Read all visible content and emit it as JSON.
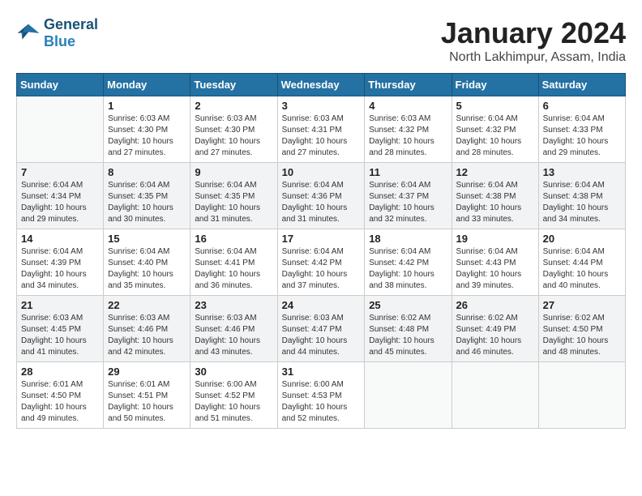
{
  "header": {
    "logo_line1": "General",
    "logo_line2": "Blue",
    "month": "January 2024",
    "location": "North Lakhimpur, Assam, India"
  },
  "days_of_week": [
    "Sunday",
    "Monday",
    "Tuesday",
    "Wednesday",
    "Thursday",
    "Friday",
    "Saturday"
  ],
  "weeks": [
    [
      {
        "day": "",
        "sunrise": "",
        "sunset": "",
        "daylight": ""
      },
      {
        "day": "1",
        "sunrise": "Sunrise: 6:03 AM",
        "sunset": "Sunset: 4:30 PM",
        "daylight": "Daylight: 10 hours and 27 minutes."
      },
      {
        "day": "2",
        "sunrise": "Sunrise: 6:03 AM",
        "sunset": "Sunset: 4:30 PM",
        "daylight": "Daylight: 10 hours and 27 minutes."
      },
      {
        "day": "3",
        "sunrise": "Sunrise: 6:03 AM",
        "sunset": "Sunset: 4:31 PM",
        "daylight": "Daylight: 10 hours and 27 minutes."
      },
      {
        "day": "4",
        "sunrise": "Sunrise: 6:03 AM",
        "sunset": "Sunset: 4:32 PM",
        "daylight": "Daylight: 10 hours and 28 minutes."
      },
      {
        "day": "5",
        "sunrise": "Sunrise: 6:04 AM",
        "sunset": "Sunset: 4:32 PM",
        "daylight": "Daylight: 10 hours and 28 minutes."
      },
      {
        "day": "6",
        "sunrise": "Sunrise: 6:04 AM",
        "sunset": "Sunset: 4:33 PM",
        "daylight": "Daylight: 10 hours and 29 minutes."
      }
    ],
    [
      {
        "day": "7",
        "sunrise": "Sunrise: 6:04 AM",
        "sunset": "Sunset: 4:34 PM",
        "daylight": "Daylight: 10 hours and 29 minutes."
      },
      {
        "day": "8",
        "sunrise": "Sunrise: 6:04 AM",
        "sunset": "Sunset: 4:35 PM",
        "daylight": "Daylight: 10 hours and 30 minutes."
      },
      {
        "day": "9",
        "sunrise": "Sunrise: 6:04 AM",
        "sunset": "Sunset: 4:35 PM",
        "daylight": "Daylight: 10 hours and 31 minutes."
      },
      {
        "day": "10",
        "sunrise": "Sunrise: 6:04 AM",
        "sunset": "Sunset: 4:36 PM",
        "daylight": "Daylight: 10 hours and 31 minutes."
      },
      {
        "day": "11",
        "sunrise": "Sunrise: 6:04 AM",
        "sunset": "Sunset: 4:37 PM",
        "daylight": "Daylight: 10 hours and 32 minutes."
      },
      {
        "day": "12",
        "sunrise": "Sunrise: 6:04 AM",
        "sunset": "Sunset: 4:38 PM",
        "daylight": "Daylight: 10 hours and 33 minutes."
      },
      {
        "day": "13",
        "sunrise": "Sunrise: 6:04 AM",
        "sunset": "Sunset: 4:38 PM",
        "daylight": "Daylight: 10 hours and 34 minutes."
      }
    ],
    [
      {
        "day": "14",
        "sunrise": "Sunrise: 6:04 AM",
        "sunset": "Sunset: 4:39 PM",
        "daylight": "Daylight: 10 hours and 34 minutes."
      },
      {
        "day": "15",
        "sunrise": "Sunrise: 6:04 AM",
        "sunset": "Sunset: 4:40 PM",
        "daylight": "Daylight: 10 hours and 35 minutes."
      },
      {
        "day": "16",
        "sunrise": "Sunrise: 6:04 AM",
        "sunset": "Sunset: 4:41 PM",
        "daylight": "Daylight: 10 hours and 36 minutes."
      },
      {
        "day": "17",
        "sunrise": "Sunrise: 6:04 AM",
        "sunset": "Sunset: 4:42 PM",
        "daylight": "Daylight: 10 hours and 37 minutes."
      },
      {
        "day": "18",
        "sunrise": "Sunrise: 6:04 AM",
        "sunset": "Sunset: 4:42 PM",
        "daylight": "Daylight: 10 hours and 38 minutes."
      },
      {
        "day": "19",
        "sunrise": "Sunrise: 6:04 AM",
        "sunset": "Sunset: 4:43 PM",
        "daylight": "Daylight: 10 hours and 39 minutes."
      },
      {
        "day": "20",
        "sunrise": "Sunrise: 6:04 AM",
        "sunset": "Sunset: 4:44 PM",
        "daylight": "Daylight: 10 hours and 40 minutes."
      }
    ],
    [
      {
        "day": "21",
        "sunrise": "Sunrise: 6:03 AM",
        "sunset": "Sunset: 4:45 PM",
        "daylight": "Daylight: 10 hours and 41 minutes."
      },
      {
        "day": "22",
        "sunrise": "Sunrise: 6:03 AM",
        "sunset": "Sunset: 4:46 PM",
        "daylight": "Daylight: 10 hours and 42 minutes."
      },
      {
        "day": "23",
        "sunrise": "Sunrise: 6:03 AM",
        "sunset": "Sunset: 4:46 PM",
        "daylight": "Daylight: 10 hours and 43 minutes."
      },
      {
        "day": "24",
        "sunrise": "Sunrise: 6:03 AM",
        "sunset": "Sunset: 4:47 PM",
        "daylight": "Daylight: 10 hours and 44 minutes."
      },
      {
        "day": "25",
        "sunrise": "Sunrise: 6:02 AM",
        "sunset": "Sunset: 4:48 PM",
        "daylight": "Daylight: 10 hours and 45 minutes."
      },
      {
        "day": "26",
        "sunrise": "Sunrise: 6:02 AM",
        "sunset": "Sunset: 4:49 PM",
        "daylight": "Daylight: 10 hours and 46 minutes."
      },
      {
        "day": "27",
        "sunrise": "Sunrise: 6:02 AM",
        "sunset": "Sunset: 4:50 PM",
        "daylight": "Daylight: 10 hours and 48 minutes."
      }
    ],
    [
      {
        "day": "28",
        "sunrise": "Sunrise: 6:01 AM",
        "sunset": "Sunset: 4:50 PM",
        "daylight": "Daylight: 10 hours and 49 minutes."
      },
      {
        "day": "29",
        "sunrise": "Sunrise: 6:01 AM",
        "sunset": "Sunset: 4:51 PM",
        "daylight": "Daylight: 10 hours and 50 minutes."
      },
      {
        "day": "30",
        "sunrise": "Sunrise: 6:00 AM",
        "sunset": "Sunset: 4:52 PM",
        "daylight": "Daylight: 10 hours and 51 minutes."
      },
      {
        "day": "31",
        "sunrise": "Sunrise: 6:00 AM",
        "sunset": "Sunset: 4:53 PM",
        "daylight": "Daylight: 10 hours and 52 minutes."
      },
      {
        "day": "",
        "sunrise": "",
        "sunset": "",
        "daylight": ""
      },
      {
        "day": "",
        "sunrise": "",
        "sunset": "",
        "daylight": ""
      },
      {
        "day": "",
        "sunrise": "",
        "sunset": "",
        "daylight": ""
      }
    ]
  ]
}
